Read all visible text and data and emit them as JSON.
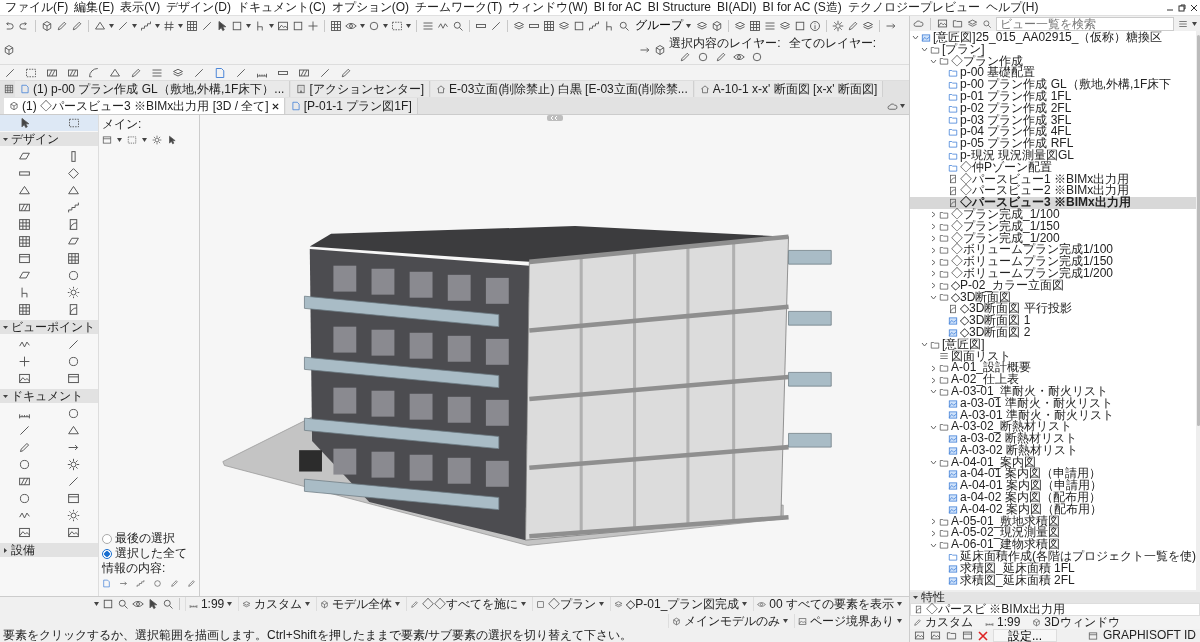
{
  "menu": [
    "ファイル(F)",
    "編集(E)",
    "表示(V)",
    "デザイン(D)",
    "ドキュメント(C)",
    "オプション(O)",
    "チームワーク(T)",
    "ウィンドウ(W)",
    "BI for AC",
    "BI Structure",
    "BI(ADI)",
    "BI for AC (S造)",
    "テクノロジープレビュー",
    "ヘルプ(H)"
  ],
  "toolbar": {
    "group_label": "グループ",
    "layer_labels": [
      "選択内容のレイヤー:",
      "全てのレイヤー:"
    ]
  },
  "tabs": [
    {
      "label": "(1) p-00 プラン作成 GL（敷地,外構,1F床下）...",
      "kind": "plan",
      "selected": false
    },
    {
      "label": "[アクションセンター]",
      "kind": "action",
      "selected": false
    },
    {
      "label": "E-03立面(削除禁止) 白黒 [E-03立面(削除禁...",
      "kind": "elevation",
      "selected": false
    },
    {
      "label": "A-10-1 x-x' 断面図 [x-x' 断面図]",
      "kind": "section",
      "selected": false
    },
    {
      "label": "(1) ◇パースビュー3 ※BIMx出力用 [3D / 全て]",
      "kind": "perspective",
      "selected": true
    },
    {
      "label": "[P-01-1 プラン図1F]",
      "kind": "plan",
      "selected": false
    }
  ],
  "toolbox": {
    "sections": [
      {
        "label": "デザイン",
        "expanded": true
      },
      {
        "label": "ビューポイント",
        "expanded": true
      },
      {
        "label": "ドキュメント",
        "expanded": true
      },
      {
        "label": "設備",
        "expanded": false
      }
    ]
  },
  "info_box": {
    "title": "メイン:",
    "options": [
      {
        "label": "最後の選択",
        "selected": false
      },
      {
        "label": "選択した全て",
        "selected": true
      }
    ],
    "content_label": "情報の内容:"
  },
  "navigator": {
    "search": {
      "placeholder": "ビュー一覧を検索"
    },
    "tree": [
      {
        "label": "[意匠図]25_015_AA02915_（仮称）糖換区",
        "kind": "project",
        "expanded": true,
        "selected": false,
        "children": [
          {
            "label": "[プラン]",
            "kind": "folder",
            "expanded": true,
            "selected": false,
            "children": [
              {
                "label": "◇プラン作成",
                "kind": "folder",
                "expanded": true,
                "selected": false,
                "children": [
                  {
                    "label": "p-00 基礎配置",
                    "kind": "view",
                    "selected": false
                  },
                  {
                    "label": "p-00 プラン作成 GL（敷地,外構,1F床下",
                    "kind": "view",
                    "selected": false
                  },
                  {
                    "label": "p-01 プラン作成 1FL",
                    "kind": "view",
                    "selected": false
                  },
                  {
                    "label": "p-02 プラン作成 2FL",
                    "kind": "view",
                    "selected": false
                  },
                  {
                    "label": "p-03 プラン作成 3FL",
                    "kind": "view",
                    "selected": false
                  },
                  {
                    "label": "p-04 プラン作成 4FL",
                    "kind": "view",
                    "selected": false
                  },
                  {
                    "label": "p-05 プラン作成 RFL",
                    "kind": "view",
                    "selected": false
                  },
                  {
                    "label": "p-現況 現況測量図GL",
                    "kind": "view",
                    "selected": false
                  },
                  {
                    "label": "◇仲Pゾーン配置",
                    "kind": "view",
                    "selected": false
                  },
                  {
                    "label": "◇パースビュー1 ※BIMx出力用",
                    "kind": "perspective",
                    "selected": false
                  },
                  {
                    "label": "◇パースビュー2 ※BIMx出力用",
                    "kind": "perspective",
                    "selected": false
                  },
                  {
                    "label": "◇パースビュー3 ※BIMx出力用",
                    "kind": "perspective",
                    "selected": true
                  }
                ]
              },
              {
                "label": "◇プラン完成_1/100",
                "kind": "folder",
                "expanded": false,
                "selected": false
              },
              {
                "label": "◇プラン完成_1/150",
                "kind": "folder",
                "expanded": false,
                "selected": false
              },
              {
                "label": "◇プラン完成_1/200",
                "kind": "folder",
                "expanded": false,
                "selected": false
              },
              {
                "label": "◇ボリュームプラン完成1/100",
                "kind": "folder",
                "expanded": false,
                "selected": false
              },
              {
                "label": "◇ボリュームプラン完成1/150",
                "kind": "folder",
                "expanded": false,
                "selected": false
              },
              {
                "label": "◇ボリュームプラン完成1/200",
                "kind": "folder",
                "expanded": false,
                "selected": false
              },
              {
                "label": "◇P-02_カラー立面図",
                "kind": "folder",
                "expanded": false,
                "selected": false
              },
              {
                "label": "◇3D断面図",
                "kind": "folder",
                "expanded": true,
                "selected": false,
                "children": [
                  {
                    "label": "◇3D断面図 平行投影",
                    "kind": "perspective",
                    "selected": false
                  },
                  {
                    "label": "◇3D断面図 1",
                    "kind": "drawing",
                    "selected": false
                  },
                  {
                    "label": "◇3D断面図 2",
                    "kind": "drawing",
                    "selected": false
                  }
                ]
              }
            ]
          },
          {
            "label": "[意匠図]",
            "kind": "folder",
            "expanded": true,
            "selected": false,
            "children": [
              {
                "label": "図面リスト",
                "kind": "list",
                "selected": false
              },
              {
                "label": "A-01_設計概要",
                "kind": "folder",
                "expanded": false,
                "selected": false
              },
              {
                "label": "A-02_仕上表",
                "kind": "folder",
                "expanded": false,
                "selected": false
              },
              {
                "label": "A-03-01_準耐火・耐火リスト",
                "kind": "folder",
                "expanded": true,
                "selected": false,
                "children": [
                  {
                    "label": "a-03-01 準耐火・耐火リスト",
                    "kind": "drawing",
                    "selected": false
                  },
                  {
                    "label": "A-03-01 準耐火・耐火リスト",
                    "kind": "drawing",
                    "selected": false
                  }
                ]
              },
              {
                "label": "A-03-02_断熱材リスト",
                "kind": "folder",
                "expanded": true,
                "selected": false,
                "children": [
                  {
                    "label": "a-03-02 断熱材リスト",
                    "kind": "drawing",
                    "selected": false
                  },
                  {
                    "label": "A-03-02 断熱材リスト",
                    "kind": "drawing",
                    "selected": false
                  }
                ]
              },
              {
                "label": "A-04-01_案内図",
                "kind": "folder",
                "expanded": true,
                "selected": false,
                "children": [
                  {
                    "label": "a-04-01 案内図（申請用）",
                    "kind": "drawing",
                    "selected": false
                  },
                  {
                    "label": "A-04-01 案内図（申請用）",
                    "kind": "drawing",
                    "selected": false
                  },
                  {
                    "label": "a-04-02 案内図（配布用）",
                    "kind": "drawing",
                    "selected": false
                  },
                  {
                    "label": "A-04-02 案内図（配布用）",
                    "kind": "drawing",
                    "selected": false
                  }
                ]
              },
              {
                "label": "A-05-01_敷地求積図",
                "kind": "folder",
                "expanded": false,
                "selected": false
              },
              {
                "label": "A-05-02_現況測量図",
                "kind": "folder",
                "expanded": false,
                "selected": false
              },
              {
                "label": "A-06-01_建物求積図",
                "kind": "folder",
                "expanded": true,
                "selected": false,
                "children": [
                  {
                    "label": "延床面積作成(各階はプロジェクト一覧を使)",
                    "kind": "view",
                    "selected": false
                  },
                  {
                    "label": "求積図_延床面積 1FL",
                    "kind": "drawing",
                    "selected": false
                  },
                  {
                    "label": "求積図_延床面積 2FL",
                    "kind": "drawing",
                    "selected": false
                  }
                ]
              }
            ]
          }
        ]
      }
    ],
    "properties": {
      "title": "特性",
      "expanded": true,
      "rows": [
        {
          "kind": "name",
          "value": "◇パースビ ※BIMx出力用"
        },
        {
          "kind": "layers",
          "value": "カスタム"
        },
        {
          "kind": "scale",
          "value": "1:99"
        },
        {
          "kind": "window",
          "value": "3Dウィンドウ"
        }
      ],
      "button": "設定..."
    },
    "footer": "GRAPHISOFT ID"
  },
  "status_bar": {
    "items": [
      {
        "kind": "scale",
        "label": "1:99"
      },
      {
        "kind": "layers",
        "label": "カスタム"
      },
      {
        "kind": "model",
        "label": "モデル全体"
      },
      {
        "kind": "pen",
        "label": "◇◇すべてを施に"
      },
      {
        "kind": "plan",
        "label": "◇プラン"
      },
      {
        "kind": "layers",
        "label": "◇P-01_プラン図完成"
      },
      {
        "kind": "eye",
        "label": "00 すべての要素を表示"
      },
      {
        "kind": "model",
        "label": "メインモデルのみ"
      },
      {
        "kind": "page",
        "label": "ページ境界あり"
      }
    ],
    "message": "要素をクリックするか、選択範囲を描画します。Ctrl+Shiftを押したままで要素/サブ要素の選択を切り替えて下さい。"
  }
}
